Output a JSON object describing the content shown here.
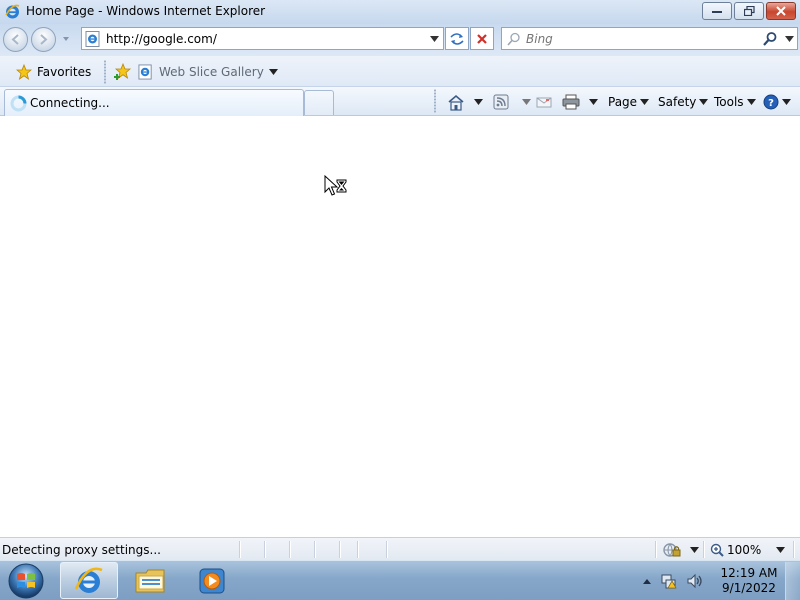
{
  "window": {
    "title": "Home Page - Windows Internet Explorer",
    "app_icon": "ie-icon",
    "controls": {
      "minimize_icon": "minimize-icon",
      "maximize_icon": "restore-icon",
      "close_icon": "close-icon"
    }
  },
  "address_bar": {
    "url": "http://google.com/",
    "page_icon": "ie-page-icon",
    "refresh_icon": "refresh-icon",
    "stop_icon": "stop-icon"
  },
  "search": {
    "placeholder": "Bing",
    "icon": "search-icon"
  },
  "favorites_bar": {
    "favorites_label": "Favorites",
    "add_favorite_icon": "add-favorite-icon",
    "web_slice_label": "Web Slice Gallery"
  },
  "tabs": [
    {
      "title": "Connecting...",
      "icon": "loading-spinner-icon",
      "active": true
    }
  ],
  "command_bar": {
    "home_icon": "home-icon",
    "feeds_icon": "feeds-icon",
    "mail_icon": "mail-icon",
    "print_icon": "print-icon",
    "page_label": "Page",
    "safety_label": "Safety",
    "tools_label": "Tools",
    "help_icon": "help-icon"
  },
  "content": {
    "cursor": "busy-cursor-icon"
  },
  "status_bar": {
    "text": "Detecting proxy settings...",
    "zone_icon": "protected-mode-icon",
    "zoom": "100%"
  },
  "taskbar": {
    "pinned": [
      {
        "name": "internet-explorer",
        "active": true
      },
      {
        "name": "windows-explorer",
        "active": false
      },
      {
        "name": "media-player",
        "active": false
      }
    ],
    "clock_time": "12:19 AM",
    "clock_date": "9/1/2022"
  },
  "colors": {
    "title_bg": "#c6d8ee",
    "close_button": "#c8462e",
    "taskbar": "#86a7c9"
  }
}
